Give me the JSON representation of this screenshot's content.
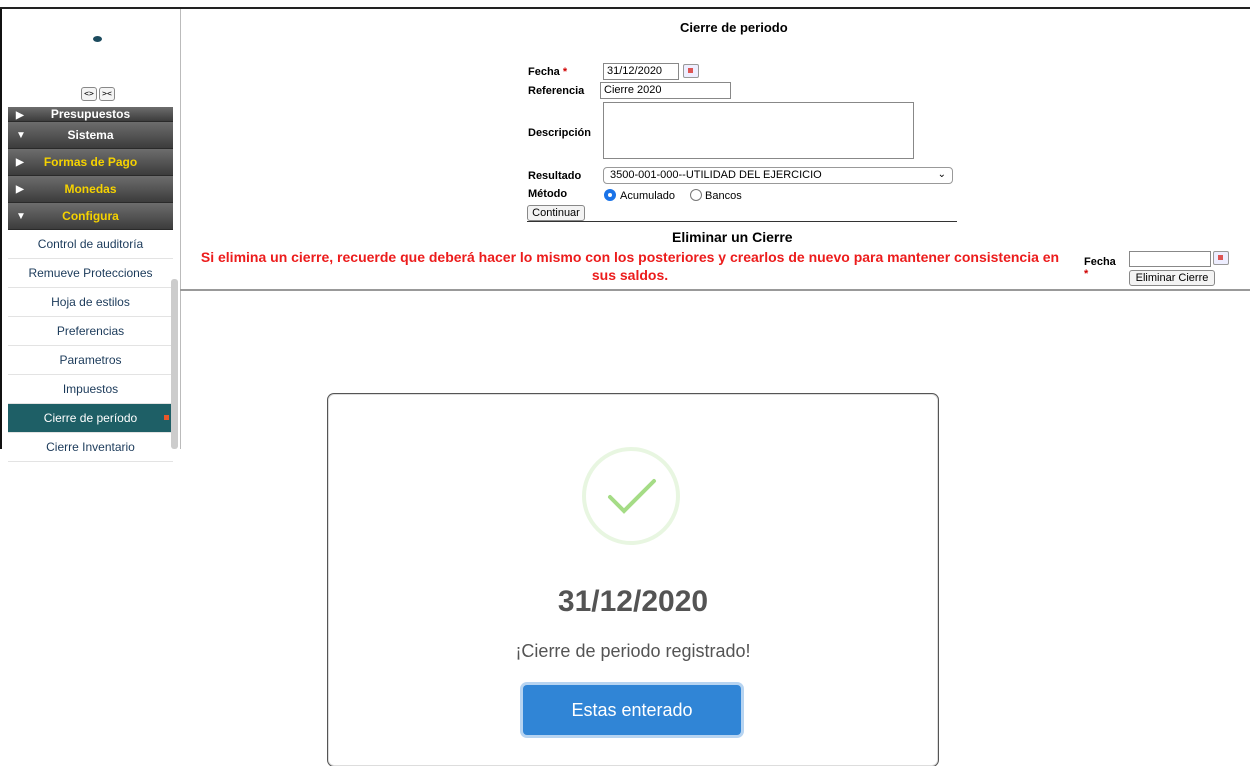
{
  "sidebar": {
    "toggle_expand": "<>",
    "toggle_collapse": "><",
    "sections": [
      {
        "label": "Presupuestos",
        "arrow": "▶",
        "yellow": false
      },
      {
        "label": "Sistema",
        "arrow": "▼",
        "yellow": false
      },
      {
        "label": "Formas de Pago",
        "arrow": "▶",
        "yellow": true
      },
      {
        "label": "Monedas",
        "arrow": "▶",
        "yellow": true
      },
      {
        "label": "Configura",
        "arrow": "▼",
        "yellow": true
      }
    ],
    "items": [
      "Control de auditoría",
      "Remueve Protecciones",
      "Hoja de estilos",
      "Preferencias",
      "Parametros",
      "Impuestos",
      "Cierre de período",
      "Cierre Inventario"
    ],
    "active_item": "Cierre de período"
  },
  "form": {
    "title": "Cierre de periodo",
    "fecha_label": "Fecha",
    "required_mark": "*",
    "fecha_value": "31/12/2020",
    "referencia_label": "Referencia",
    "referencia_value": "Cierre 2020",
    "descripcion_label": "Descripción",
    "descripcion_value": "",
    "resultado_label": "Resultado",
    "resultado_value": "3500-001-000--UTILIDAD DEL EJERCICIO",
    "metodo_label": "Método",
    "metodo_option1": "Acumulado",
    "metodo_option2": "Bancos",
    "metodo_selected": "Acumulado",
    "continuar_label": "Continuar"
  },
  "eliminar": {
    "title": "Eliminar un Cierre",
    "warning": "Si elimina un cierre, recuerde que deberá hacer lo mismo con los posteriores y crearlos de nuevo para mantener consistencia en sus saldos.",
    "fecha_label": "Fecha",
    "required_mark": "*",
    "fecha_value": "",
    "button_label": "Eliminar Cierre"
  },
  "modal": {
    "icon": "check-icon",
    "title": "31/12/2020",
    "message": "¡Cierre de periodo registrado!",
    "button_label": "Estas enterado",
    "accent": "#3085d6",
    "success_color": "#a5dc86"
  }
}
